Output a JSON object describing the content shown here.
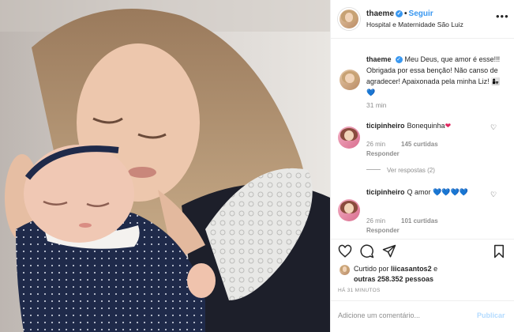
{
  "post": {
    "username": "thaeme",
    "follow_label": "Seguir",
    "separator": "•",
    "location": "Hospital e Maternidade São Luiz",
    "more_label": "•••"
  },
  "caption": {
    "username": "thaeme",
    "text": "Meu Deus, que amor é esse!!! Obrigada por essa benção! Não canso de agradecer! Apaixonada pela minha Liz!",
    "emoji": "👩‍👧💙",
    "time": "31 min"
  },
  "comments": [
    {
      "username": "ticipinheiro",
      "text": "Bonequinha",
      "emoji": "❤",
      "time": "26 min",
      "likes": "145 curtidas",
      "reply_label": "Responder"
    },
    {
      "username": "ticipinheiro",
      "text": "Q amor",
      "emoji": "💙💙💙💙",
      "time": "26 min",
      "likes": "101 curtidas",
      "reply_label": "Responder"
    }
  ],
  "view_replies": "Ver respostas (2)",
  "likes": {
    "prefix": "Curtido por",
    "user": "liicasantos2",
    "connector": "e",
    "others": "outras 258.352 pessoas"
  },
  "timestamp": "HÁ 31 MINUTOS",
  "comment_box": {
    "placeholder": "Adicione um comentário...",
    "publish_label": "Publicar"
  },
  "icons": {
    "like": "heart-icon",
    "comment": "comment-icon",
    "share": "share-icon",
    "save": "bookmark-icon",
    "verified": "verified-icon"
  },
  "colors": {
    "link": "#3897f0",
    "muted": "#8e8e8e",
    "publish_disabled": "#b3dbff"
  }
}
